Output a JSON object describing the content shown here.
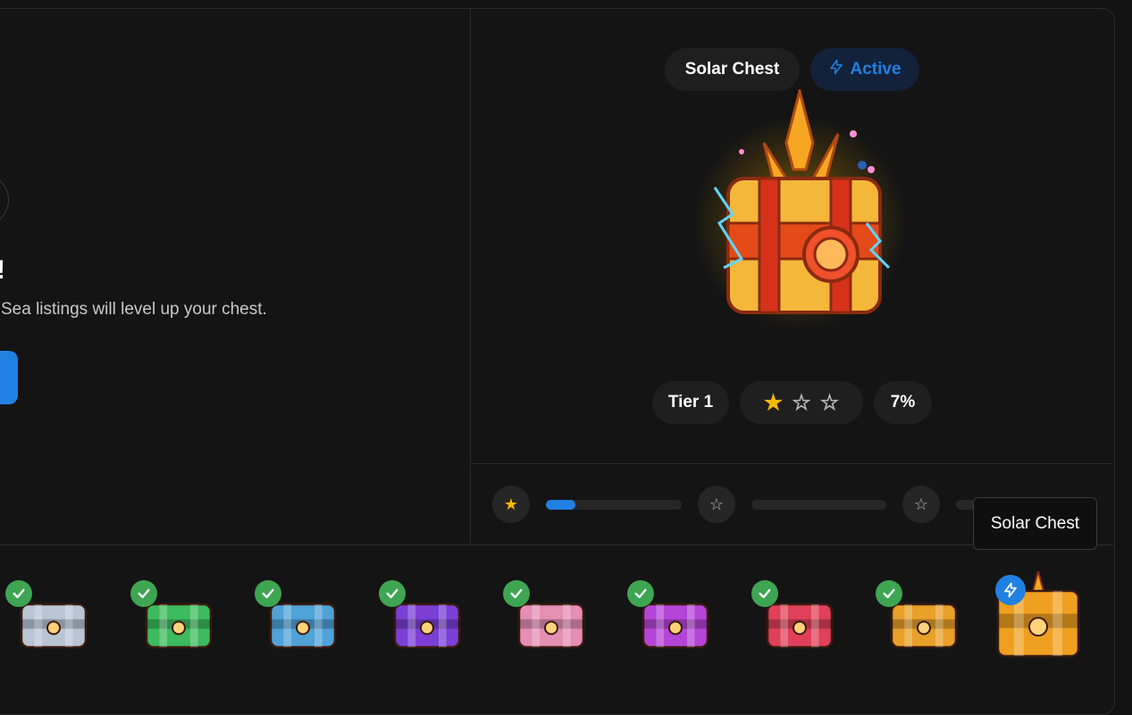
{
  "left": {
    "heading": "!",
    "subtext": "Sea listings will level up your chest."
  },
  "chest": {
    "name": "Solar Chest",
    "status": "Active",
    "tier": "Tier 1",
    "stars_filled": 1,
    "stars_total": 3,
    "progress_percent": "7%"
  },
  "progress": {
    "segments": [
      {
        "icon": "star-filled-icon",
        "fill_fraction": 0.22
      },
      {
        "icon": "star-outline-icon",
        "fill_fraction": 0
      },
      {
        "icon": "star-outline-icon",
        "fill_fraction": 0
      }
    ]
  },
  "tooltip": {
    "label": "Solar Chest"
  },
  "gallery": {
    "chests": [
      {
        "state": "completed",
        "color": "#b9c4d4"
      },
      {
        "state": "completed",
        "color": "#3dbb5e"
      },
      {
        "state": "completed",
        "color": "#4fa3d8"
      },
      {
        "state": "completed",
        "color": "#7b3fd6"
      },
      {
        "state": "completed",
        "color": "#e58fb5"
      },
      {
        "state": "completed",
        "color": "#b545d8"
      },
      {
        "state": "completed",
        "color": "#e0405a"
      },
      {
        "state": "completed",
        "color": "#e8a028"
      },
      {
        "state": "active",
        "color": "#f0a020"
      }
    ]
  },
  "colors": {
    "accent": "#2081e2",
    "check": "#3ea552",
    "star": "#f5b800"
  }
}
